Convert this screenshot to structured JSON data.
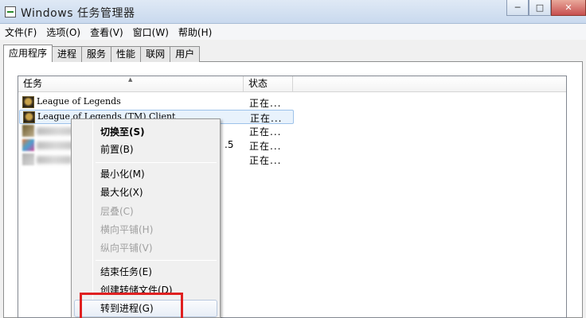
{
  "window": {
    "title": "Windows 任务管理器",
    "minimize_glyph": "─",
    "maximize_glyph": "□",
    "close_glyph": "✕",
    "app_icon": "task-manager-icon"
  },
  "menubar": {
    "items": [
      "文件(F)",
      "选项(O)",
      "查看(V)",
      "窗口(W)",
      "帮助(H)"
    ]
  },
  "tabs": {
    "items": [
      "应用程序",
      "进程",
      "服务",
      "性能",
      "联网",
      "用户"
    ],
    "active": "应用程序"
  },
  "listview": {
    "columns": [
      "任务",
      "状态"
    ],
    "sort_indicator": "▲",
    "rows": [
      {
        "name": "League of Legends",
        "status": "正在...",
        "icon": "league-of-legends-icon",
        "selected": false,
        "blurred": false
      },
      {
        "name": "League of Legends (TM) Client",
        "status": "正在...",
        "icon": "league-of-legends-icon",
        "selected": true,
        "blurred": false
      },
      {
        "name": "",
        "status": "正在...",
        "icon": "blurred-app-icon",
        "selected": false,
        "blurred": true
      },
      {
        "name": "",
        "status": "正在...",
        "icon": "blurred-app-icon",
        "selected": false,
        "blurred": true,
        "extra": ".5"
      },
      {
        "name": "",
        "status": "正在...",
        "icon": "blurred-app-icon",
        "selected": false,
        "blurred": true
      }
    ]
  },
  "context_menu": {
    "items": [
      {
        "label": "切换至(S)",
        "enabled": true,
        "default": true
      },
      {
        "label": "前置(B)",
        "enabled": true
      },
      {
        "label": "最小化(M)",
        "enabled": true
      },
      {
        "label": "最大化(X)",
        "enabled": true
      },
      {
        "label": "层叠(C)",
        "enabled": false
      },
      {
        "label": "横向平铺(H)",
        "enabled": false
      },
      {
        "label": "纵向平铺(V)",
        "enabled": false
      },
      {
        "label": "结束任务(E)",
        "enabled": true
      },
      {
        "label": "创建转储文件(D)",
        "enabled": true
      },
      {
        "label": "转到进程(G)",
        "enabled": true,
        "highlighted": true
      }
    ],
    "highlight_color": "#e02020"
  }
}
